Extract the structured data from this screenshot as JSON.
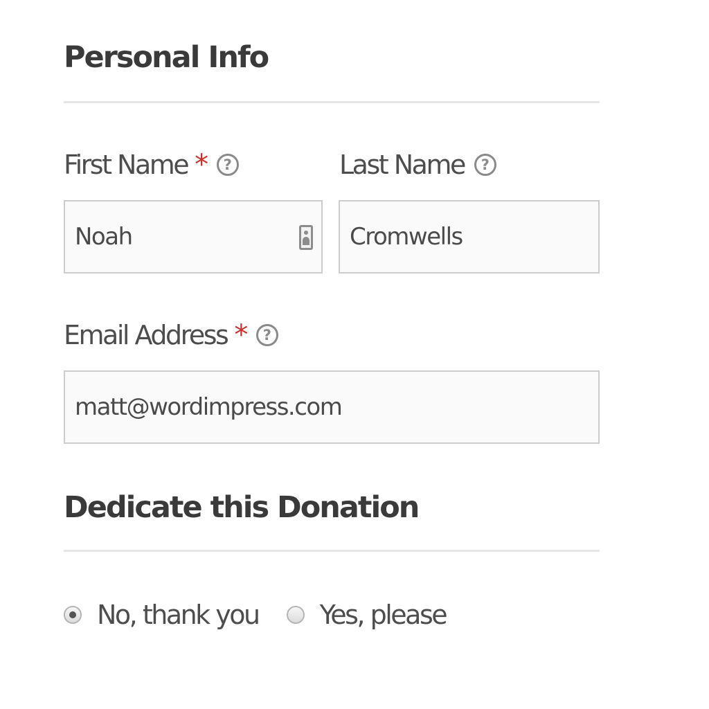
{
  "personal_info": {
    "title": "Personal Info",
    "first_name": {
      "label": "First Name",
      "required_mark": "*",
      "help_icon": "?",
      "value": "Noah",
      "trailing_icon": "contact-card-icon"
    },
    "last_name": {
      "label": "Last Name",
      "help_icon": "?",
      "value": "Cromwells"
    },
    "email": {
      "label": "Email Address",
      "required_mark": "*",
      "help_icon": "?",
      "value": "matt@wordimpress.com"
    }
  },
  "dedication": {
    "title": "Dedicate this Donation",
    "options": [
      {
        "label": "No, thank you",
        "checked": true
      },
      {
        "label": "Yes, please",
        "checked": false
      }
    ]
  },
  "colors": {
    "required": "#c9302c",
    "input_background": "#fafafa",
    "input_border": "#cccccc",
    "divider": "#e6e6e6"
  }
}
